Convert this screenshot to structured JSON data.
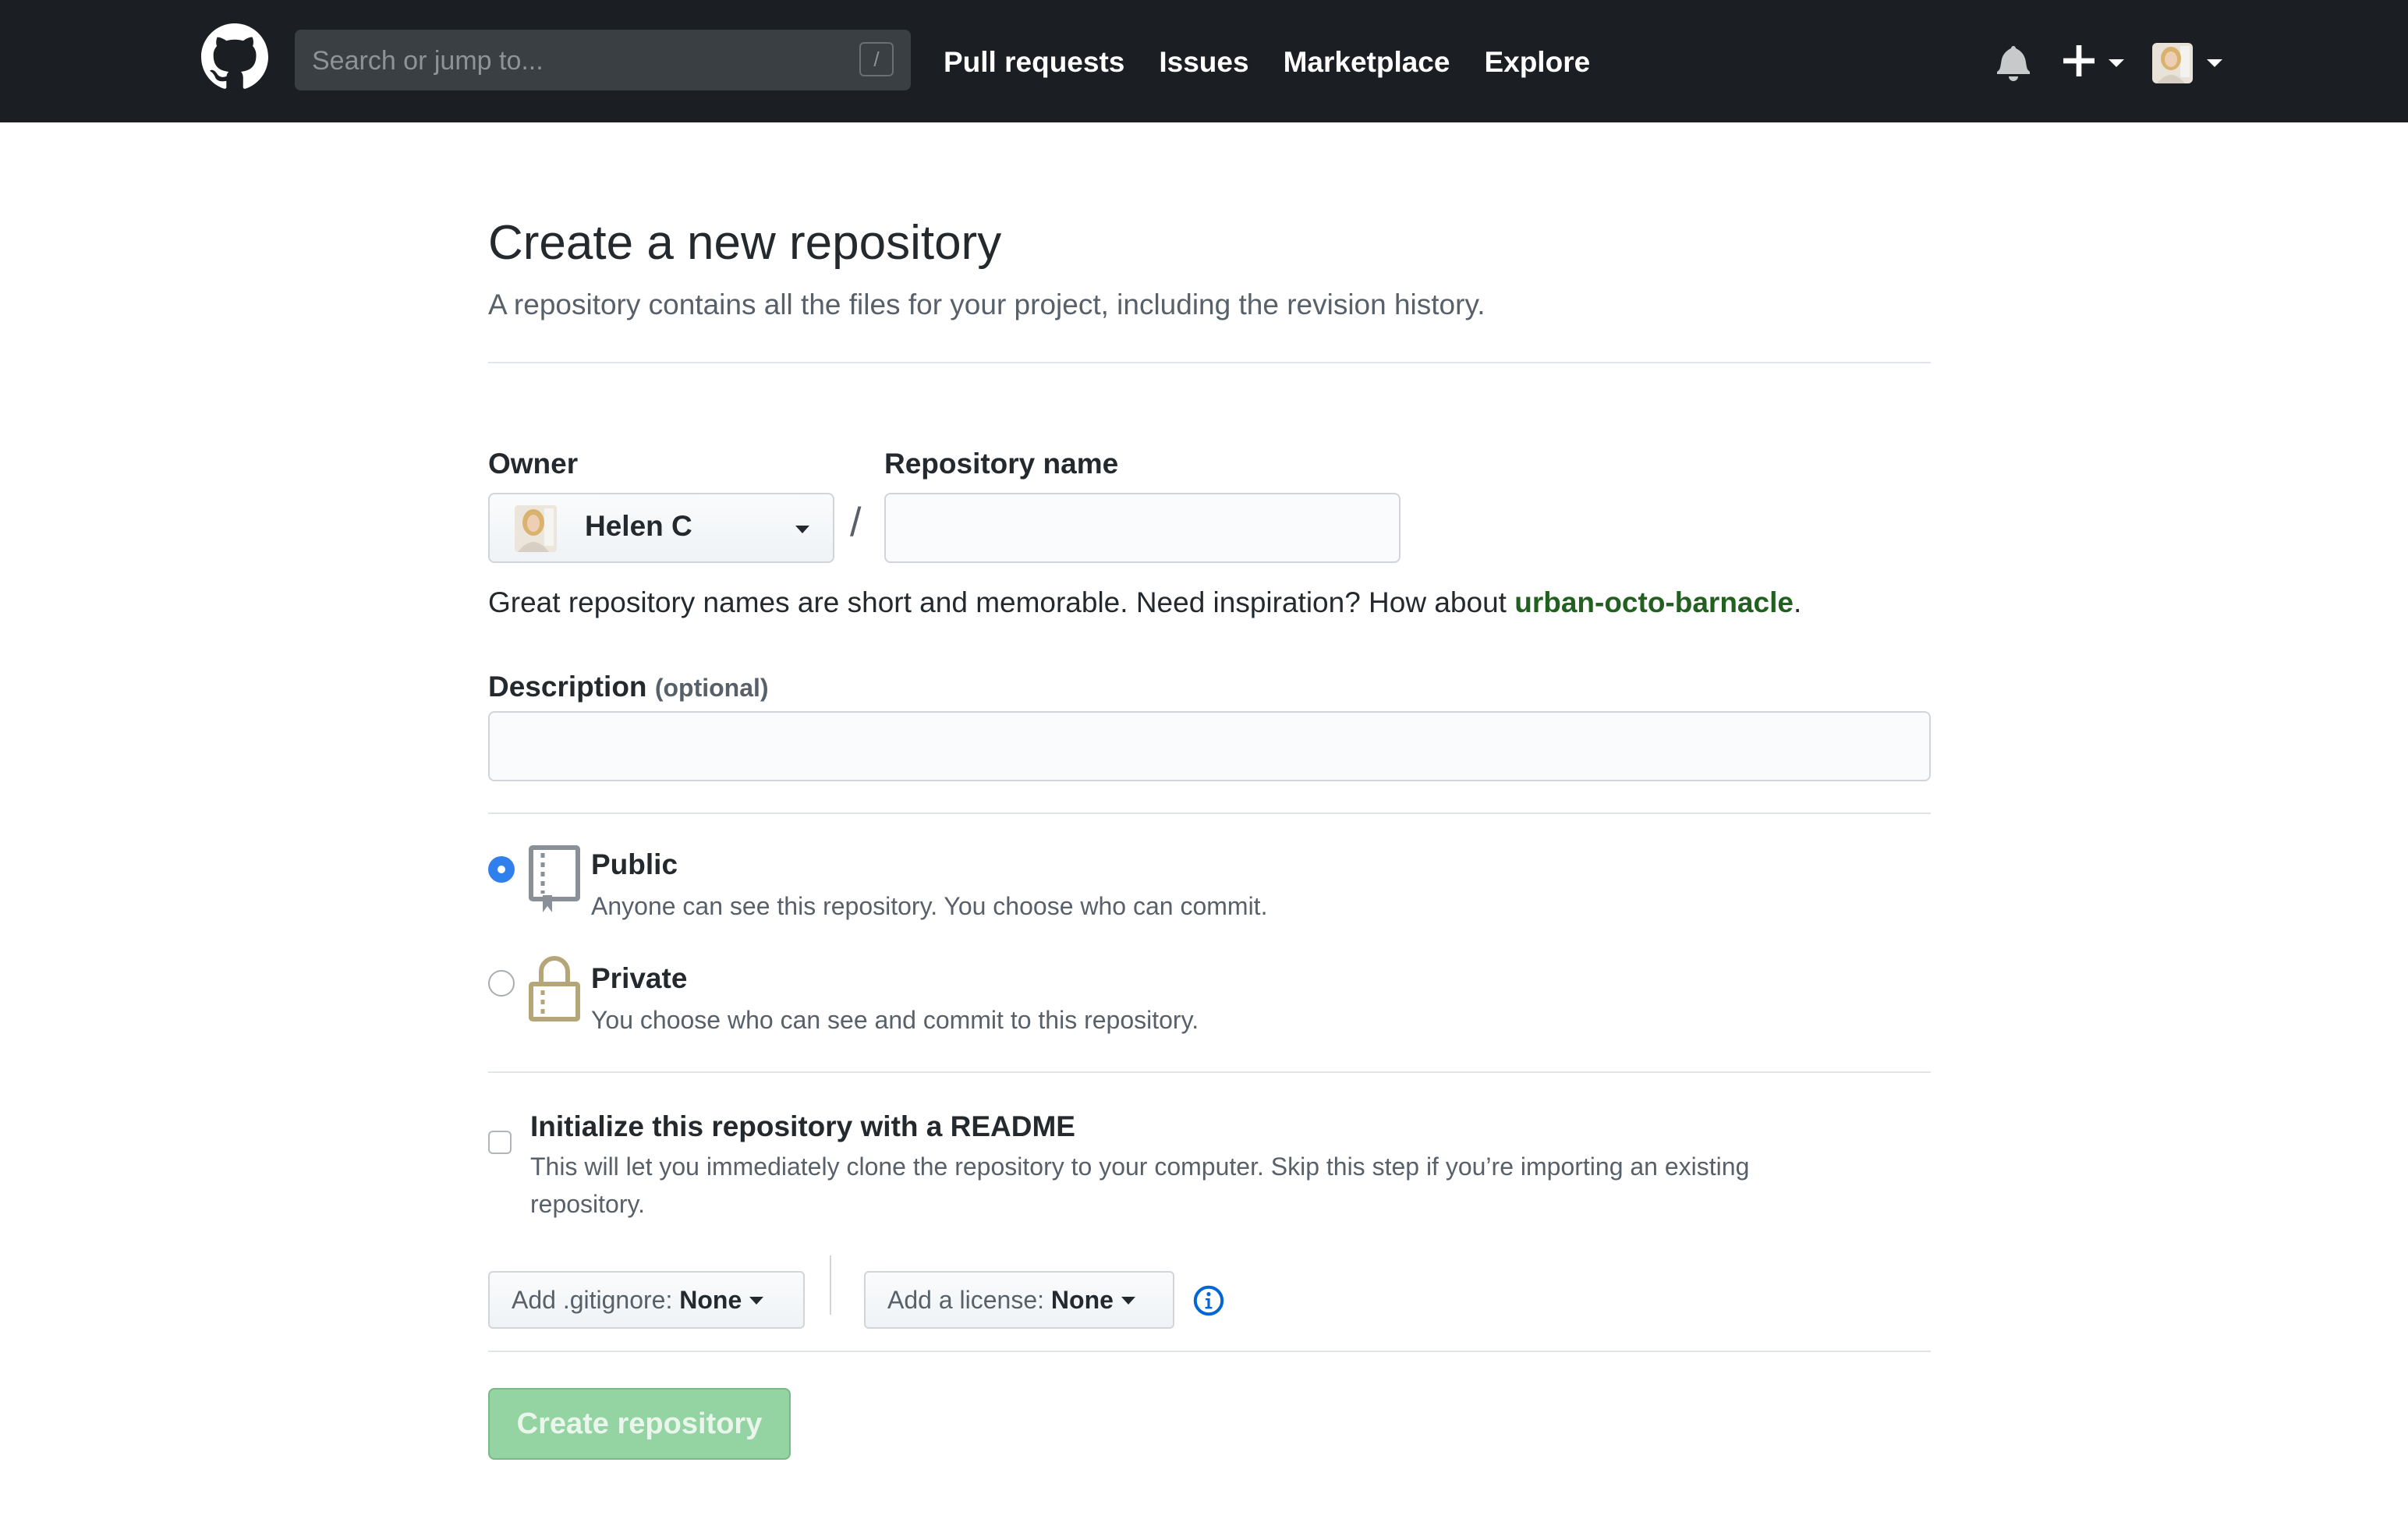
{
  "header": {
    "search_placeholder": "Search or jump to...",
    "search_shortcut": "/",
    "nav": [
      {
        "label": "Pull requests"
      },
      {
        "label": "Issues"
      },
      {
        "label": "Marketplace"
      },
      {
        "label": "Explore"
      }
    ],
    "icons": [
      "github-logo",
      "bell-icon",
      "plus-icon",
      "avatar"
    ]
  },
  "page": {
    "title": "Create a new repository",
    "subtitle": "A repository contains all the files for your project, including the revision history."
  },
  "form": {
    "owner_label": "Owner",
    "owner_value": "Helen C",
    "separator": "/",
    "repo_name_label": "Repository name",
    "repo_name_value": "",
    "hint_prefix": "Great repository names are short and memorable. Need inspiration? How about ",
    "hint_suggestion": "urban-octo-barnacle",
    "hint_suffix": ".",
    "description_label": "Description",
    "description_optional": "(optional)",
    "description_value": "",
    "visibility": [
      {
        "title": "Public",
        "desc": "Anyone can see this repository. You choose who can commit.",
        "selected": true
      },
      {
        "title": "Private",
        "desc": "You choose who can see and commit to this repository.",
        "selected": false
      }
    ],
    "readme_label": "Initialize this repository with a README",
    "readme_desc_line1": "This will let you immediately clone the repository to your computer. Skip this step if you’re importing an existing",
    "readme_desc_line2": "repository.",
    "readme_checked": false,
    "gitignore_prefix": "Add .gitignore: ",
    "gitignore_value": "None",
    "license_prefix": "Add a license: ",
    "license_value": "None",
    "submit_label": "Create repository"
  },
  "colors": {
    "header_bg": "#1b1f23",
    "suggestion": "#22601f",
    "radio_selected": "#2f80ed",
    "submit_disabled_bg": "#94d3a2",
    "info_icon": "#0366d6",
    "lock_icon": "#b5a67a"
  }
}
